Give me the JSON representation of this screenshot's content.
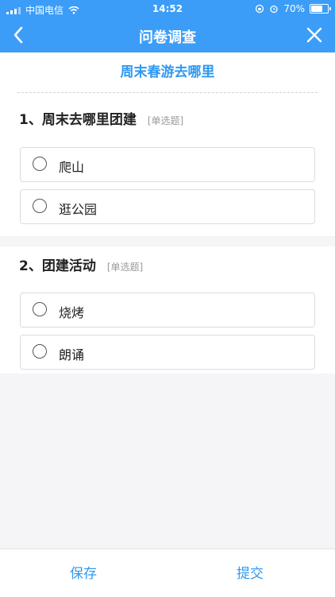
{
  "status_bar": {
    "carrier": "中国电信",
    "time": "14:52",
    "battery": "70%",
    "battery_level": 0.7
  },
  "nav": {
    "title": "问卷调查"
  },
  "survey": {
    "title": "周末春游去哪里"
  },
  "questions": [
    {
      "title": "1、周末去哪里团建",
      "type": "[单选题]",
      "options": [
        "爬山",
        "逛公园"
      ]
    },
    {
      "title": "2、团建活动",
      "type": "[单选题]",
      "options": [
        "烧烤",
        "朗诵"
      ]
    }
  ],
  "footer": {
    "save": "保存",
    "submit": "提交"
  },
  "colors": {
    "accent": "#3b9df8",
    "link": "#2f98f2"
  }
}
